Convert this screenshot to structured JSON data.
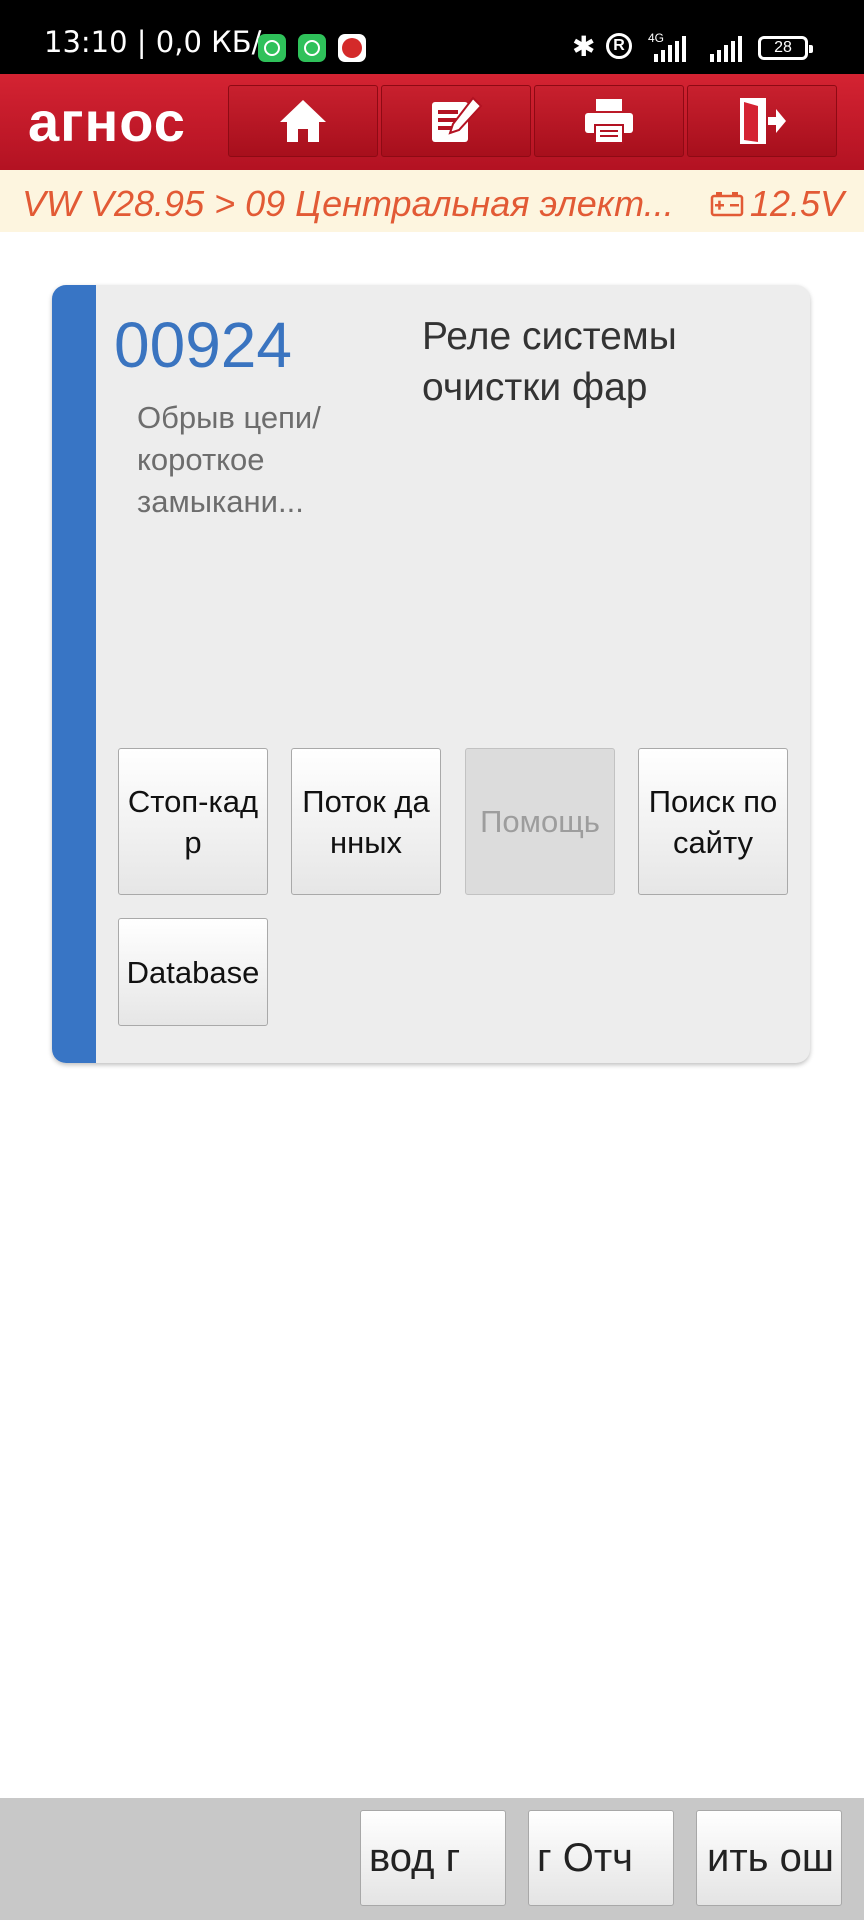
{
  "status_bar": {
    "time": "13:10 | 0,0 КБ/с",
    "network": "4G",
    "battery": "28"
  },
  "header": {
    "brand": "агнос",
    "nav": [
      {
        "icon": "home-icon"
      },
      {
        "icon": "edit-icon"
      },
      {
        "icon": "print-icon"
      },
      {
        "icon": "exit-icon"
      }
    ]
  },
  "breadcrumb": {
    "path": "VW V28.95 > 09 Центральная элект...",
    "voltage": "12.5V"
  },
  "dtc": {
    "code": "00924",
    "status": "Обрыв цепи/ короткое замыкани...",
    "description": "Реле системы очистки фар",
    "buttons": [
      {
        "label": "Стоп-кадр",
        "enabled": true
      },
      {
        "label": "Поток данных",
        "enabled": true
      },
      {
        "label": "Помощь",
        "enabled": false
      },
      {
        "label": "Поиск по сайту",
        "enabled": true
      },
      {
        "label": "Database",
        "enabled": true
      }
    ]
  },
  "bottom_bar": {
    "buttons": [
      {
        "label": "вод   г"
      },
      {
        "label": "г  Отч"
      },
      {
        "label": "ить ош"
      }
    ]
  }
}
